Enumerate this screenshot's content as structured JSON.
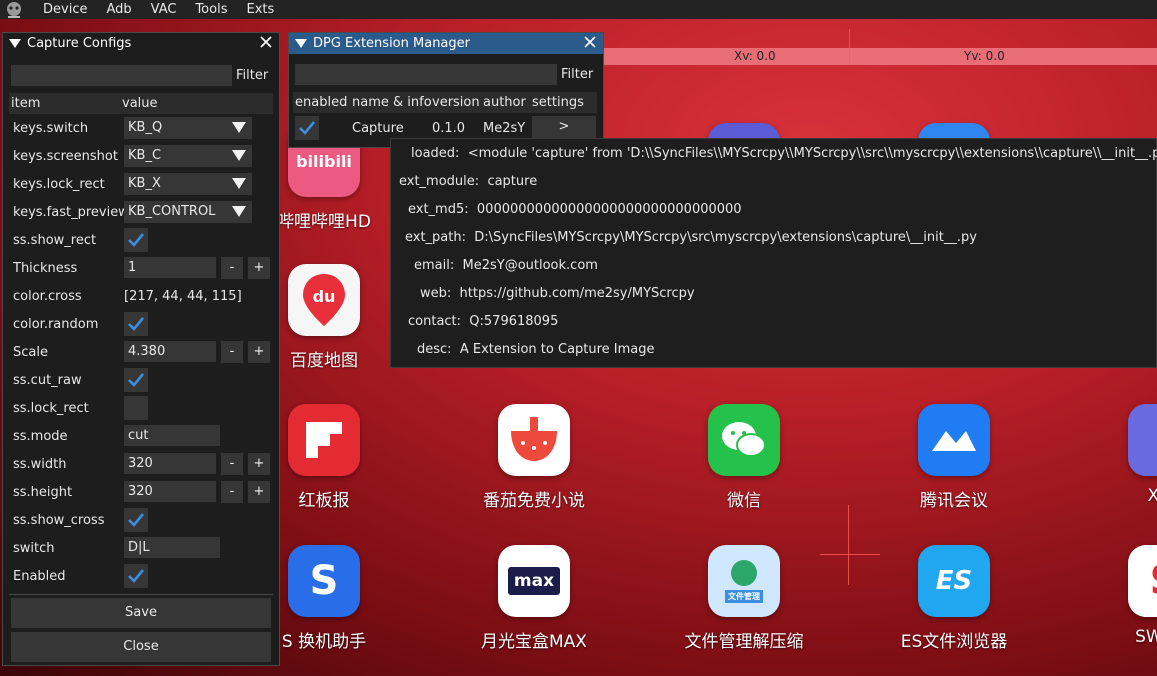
{
  "menubar": {
    "items": [
      "Device",
      "Adb",
      "VAC",
      "Tools",
      "Exts"
    ]
  },
  "screen": {
    "xv": "Xv: 0.0",
    "yv": "Yv: 0.0",
    "apps": [
      {
        "label": "哔哩哔哩HD",
        "icon": "bilibili-icon",
        "glyph": "bilibili"
      },
      {
        "label": "百度地图",
        "icon": "baidu-map-icon",
        "glyph": "du"
      },
      {
        "label": "红板报",
        "icon": "flipboard-icon",
        "glyph": ""
      },
      {
        "label": "番茄免费小说",
        "icon": "tomato-novel-icon",
        "glyph": ""
      },
      {
        "label": "微信",
        "icon": "wechat-icon",
        "glyph": ""
      },
      {
        "label": "腾讯会议",
        "icon": "tencent-meeting-icon",
        "glyph": ""
      },
      {
        "label": "XtM",
        "icon": "xtm-icon",
        "glyph": ""
      },
      {
        "label": "S 换机助手",
        "icon": "smart-switch-icon",
        "glyph": "S"
      },
      {
        "label": "月光宝盒MAX",
        "icon": "max-icon",
        "glyph": "max"
      },
      {
        "label": "文件管理解压缩",
        "icon": "file-manager-icon",
        "glyph": "文件管理"
      },
      {
        "label": "ES文件浏览器",
        "icon": "es-explorer-icon",
        "glyph": "ES"
      },
      {
        "label": "SWF Pl",
        "icon": "swf-player-icon",
        "glyph": "S"
      }
    ]
  },
  "capture": {
    "title": "Capture Configs",
    "filter_label": "Filter",
    "filter_value": "",
    "col_item": "item",
    "col_value": "value",
    "rows": {
      "keys_switch": {
        "label": "keys.switch",
        "value": "KB_Q"
      },
      "keys_screenshot": {
        "label": "keys.screenshot",
        "value": "KB_C"
      },
      "keys_lock_rect": {
        "label": "keys.lock_rect",
        "value": "KB_X"
      },
      "keys_fast_preview": {
        "label": "keys.fast_preview",
        "value": "KB_CONTROL"
      },
      "ss_show_rect": {
        "label": "ss.show_rect",
        "checked": true
      },
      "thickness": {
        "label": "Thickness",
        "value": "1"
      },
      "color_cross": {
        "label": "color.cross",
        "value": "[217, 44, 44, 115]"
      },
      "color_random": {
        "label": "color.random",
        "checked": true
      },
      "scale": {
        "label": "Scale",
        "value": "4.380"
      },
      "ss_cut_raw": {
        "label": "ss.cut_raw",
        "checked": true
      },
      "ss_lock_rect": {
        "label": "ss.lock_rect",
        "checked": false
      },
      "ss_mode": {
        "label": "ss.mode",
        "value": "cut"
      },
      "ss_width": {
        "label": "ss.width",
        "value": "320"
      },
      "ss_height": {
        "label": "ss.height",
        "value": "320"
      },
      "ss_show_cross": {
        "label": "ss.show_cross",
        "checked": true
      },
      "switch": {
        "label": "switch",
        "value": "D|L"
      },
      "enabled": {
        "label": "Enabled",
        "checked": true
      }
    },
    "minus": "-",
    "plus": "+",
    "save_label": "Save",
    "close_label": "Close"
  },
  "extmgr": {
    "title": "DPG Extension Manager",
    "filter_label": "Filter",
    "filter_value": "",
    "columns": [
      "enabled",
      "name & info",
      "version",
      "author",
      "settings"
    ],
    "row": {
      "enabled": true,
      "name": "Capture",
      "version": "0.1.0",
      "author": "Me2sY",
      "settings": ">"
    }
  },
  "tooltip": {
    "lines": [
      {
        "key": "loaded:",
        "value": "<module 'capture' from 'D:\\\\SyncFiles\\\\MYScrcpy\\\\MYScrcpy\\\\src\\\\myscrcpy\\\\extensions\\\\capture\\\\__init__.py'>"
      },
      {
        "key": "ext_module:",
        "value": "capture"
      },
      {
        "key": "ext_md5:",
        "value": "00000000000000000000000000000000"
      },
      {
        "key": "ext_path:",
        "value": "D:\\SyncFiles\\MYScrcpy\\MYScrcpy\\src\\myscrcpy\\extensions\\capture\\__init__.py"
      },
      {
        "key": "email:",
        "value": "Me2sY@outlook.com"
      },
      {
        "key": "web:",
        "value": "https://github.com/me2sy/MYScrcpy"
      },
      {
        "key": "contact:",
        "value": "Q:579618095"
      },
      {
        "key": "desc:",
        "value": "A Extension to Capture Image"
      }
    ]
  }
}
